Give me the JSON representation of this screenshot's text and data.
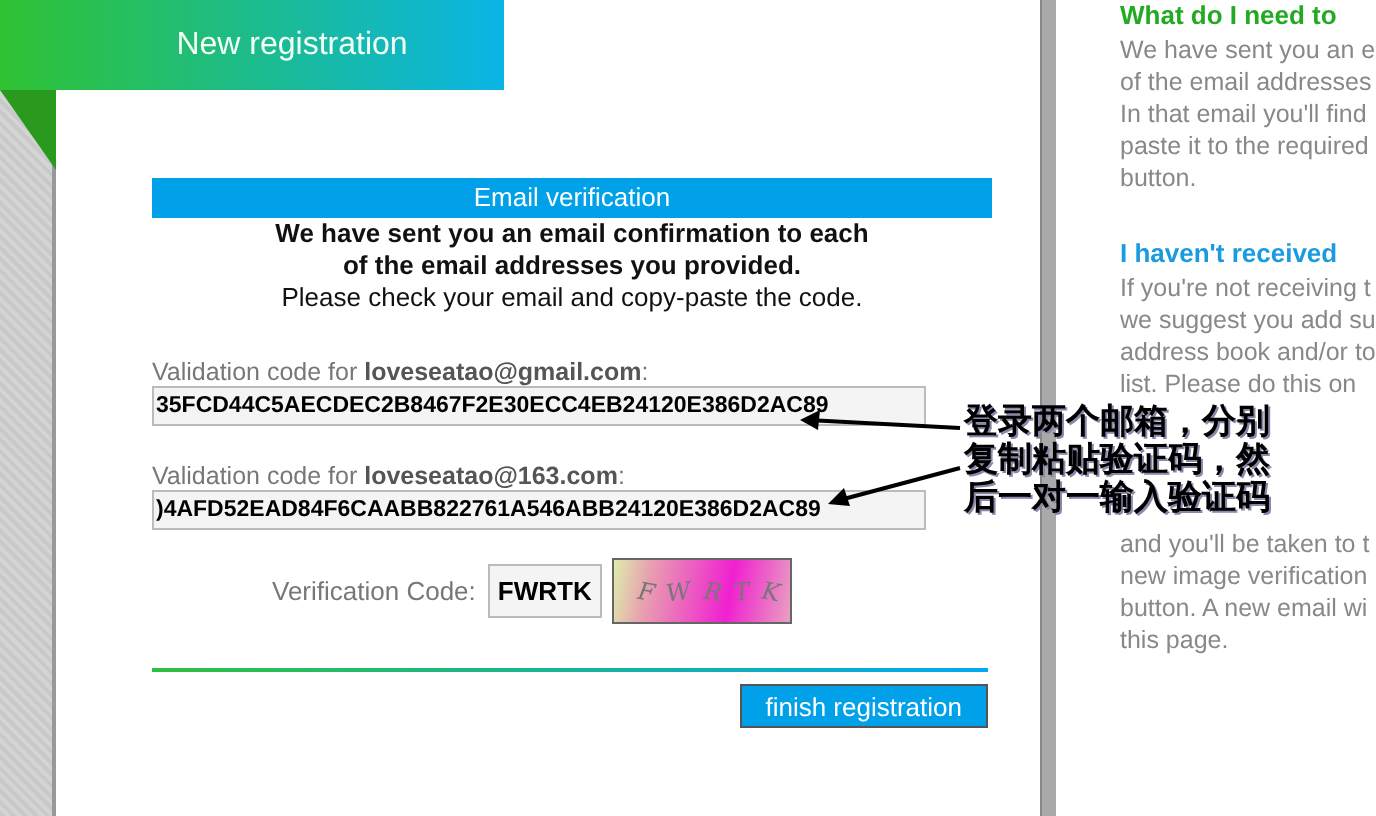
{
  "header": {
    "title": "New registration"
  },
  "panel": {
    "title": "Email verification",
    "intro_bold": [
      "We have sent you an email confirmation to each",
      "of the email addresses you provided."
    ],
    "intro": "Please check your email and copy-paste the code.",
    "codes": [
      {
        "label": "Validation code for **loveseatao@gmail.com**:",
        "value": "35FCD44C5AECDEC2B8467F2E30ECC4EB24120E386D2AC89"
      },
      {
        "label": "Validation code for **loveseatao@163.com**:",
        "value": ")4AFD52EAD84F6CAABB822761A546ABB24120E386D2AC89"
      }
    ],
    "verification": {
      "label": "Verification Code:",
      "value": "FWRTK",
      "captcha": {
        "kind": "picture",
        "glyphs": [
          "F",
          "W",
          "R",
          "T",
          "K"
        ]
      }
    },
    "submit": "finish registration"
  },
  "help": [
    {
      "kind": "heading",
      "color": "#22aa22",
      "text": "What do I need to"
    },
    {
      "kind": "line",
      "text": "We have sent you an e"
    },
    {
      "kind": "line",
      "text": "of the email addresses"
    },
    {
      "kind": "line",
      "text": "In that email you'll find"
    },
    {
      "kind": "line",
      "text": "paste it to the required"
    },
    {
      "kind": "line",
      "text": "button."
    },
    {
      "kind": "gap"
    },
    {
      "kind": "heading",
      "color": "#1a9be0",
      "text": "I haven't received"
    },
    {
      "kind": "line",
      "text": "If you're not receiving t"
    },
    {
      "kind": "line",
      "text": "we suggest you add su"
    },
    {
      "kind": "line",
      "text": "address book and/or to"
    },
    {
      "kind": "line",
      "text": "list. Please do this on"
    },
    {
      "kind": "hidden"
    },
    {
      "kind": "hidden"
    },
    {
      "kind": "hidden"
    },
    {
      "kind": "hidden"
    },
    {
      "kind": "line",
      "text": "and you'll be taken to t"
    },
    {
      "kind": "line",
      "text": "new image verification"
    },
    {
      "kind": "line",
      "text": "button. A new email wi"
    },
    {
      "kind": "line",
      "text": "this page."
    }
  ],
  "annotation": {
    "lines": [
      "登录两个邮箱，分别",
      "复制粘贴验证码，然",
      "后一对一输入验证码"
    ]
  }
}
